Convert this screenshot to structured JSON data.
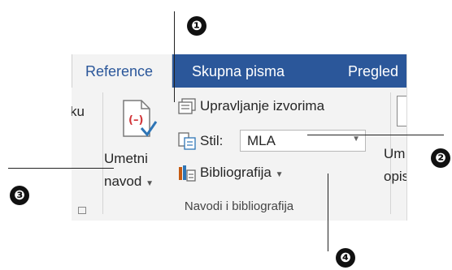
{
  "tabs": {
    "reference": "Reference",
    "mailings": "Skupna pisma",
    "review": "Pregled"
  },
  "ribbon": {
    "left_partial": "ku",
    "insert_citation_line1": "Umetni",
    "insert_citation_line2": "navod",
    "manage_sources": "Upravljanje izvorima",
    "style_label": "Stil:",
    "style_value": "MLA",
    "bibliography": "Bibliografija",
    "group_label": "Navodi i bibliografija",
    "right_partial_line1": "Um",
    "right_partial_line2": "opis"
  },
  "callouts": {
    "one": "❶",
    "two": "❷",
    "three": "❸",
    "four": "❹"
  },
  "colors": {
    "tab_bar": "#2b579a",
    "ribbon_bg": "#f3f3f3",
    "citation_red": "#d13438",
    "icon_blue": "#2e75b6"
  }
}
